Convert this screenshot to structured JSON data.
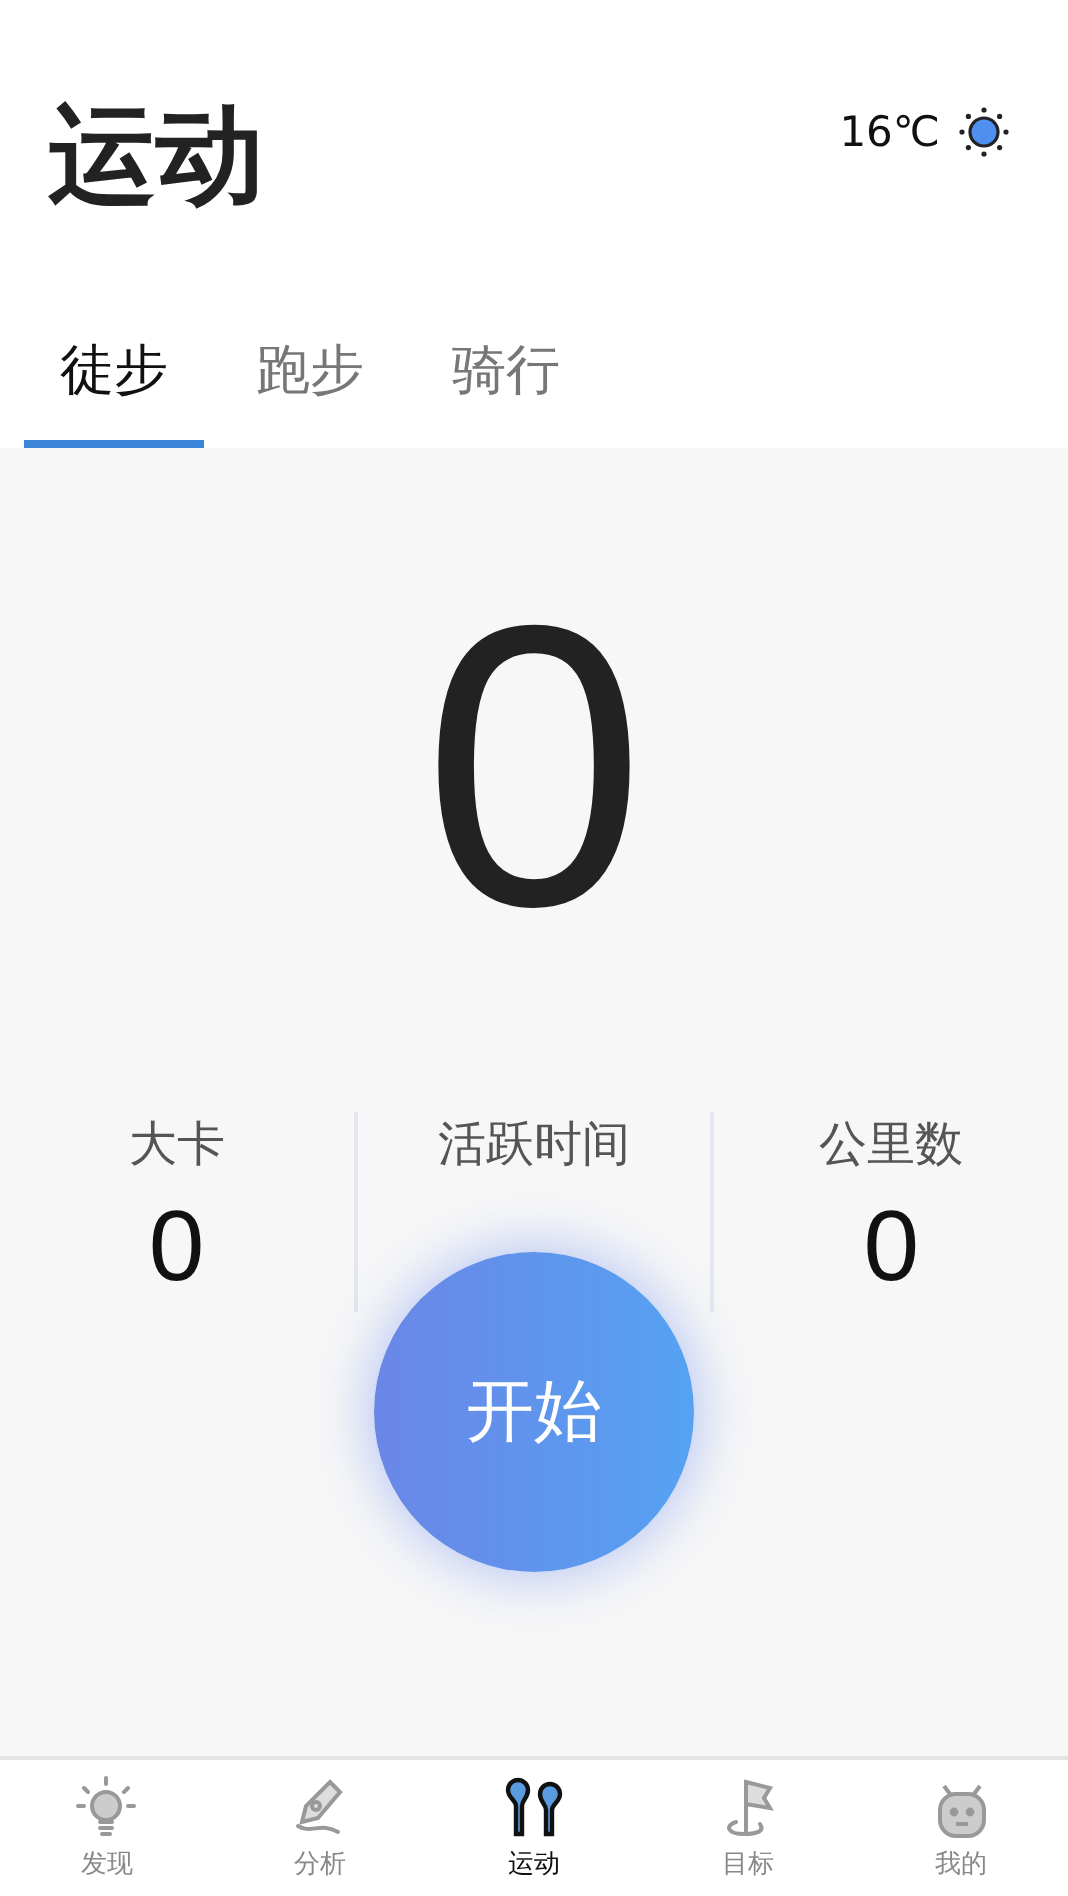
{
  "header": {
    "title": "运动",
    "temperature": "16℃"
  },
  "tabs": [
    {
      "label": "徒步",
      "selected": true
    },
    {
      "label": "跑步",
      "selected": false
    },
    {
      "label": "骑行",
      "selected": false
    }
  ],
  "counter": "0",
  "stats": [
    {
      "label": "大卡",
      "value": "0"
    },
    {
      "label": "活跃时间"
    },
    {
      "label": "公里数",
      "value": "0"
    }
  ],
  "start_button": "开始",
  "nav": [
    {
      "label": "发现",
      "kind": "bulb",
      "selected": false
    },
    {
      "label": "分析",
      "kind": "pen",
      "selected": false
    },
    {
      "label": "运动",
      "kind": "earbuds",
      "selected": true
    },
    {
      "label": "目标",
      "kind": "flag",
      "selected": false
    },
    {
      "label": "我的",
      "kind": "robot",
      "selected": false
    }
  ]
}
